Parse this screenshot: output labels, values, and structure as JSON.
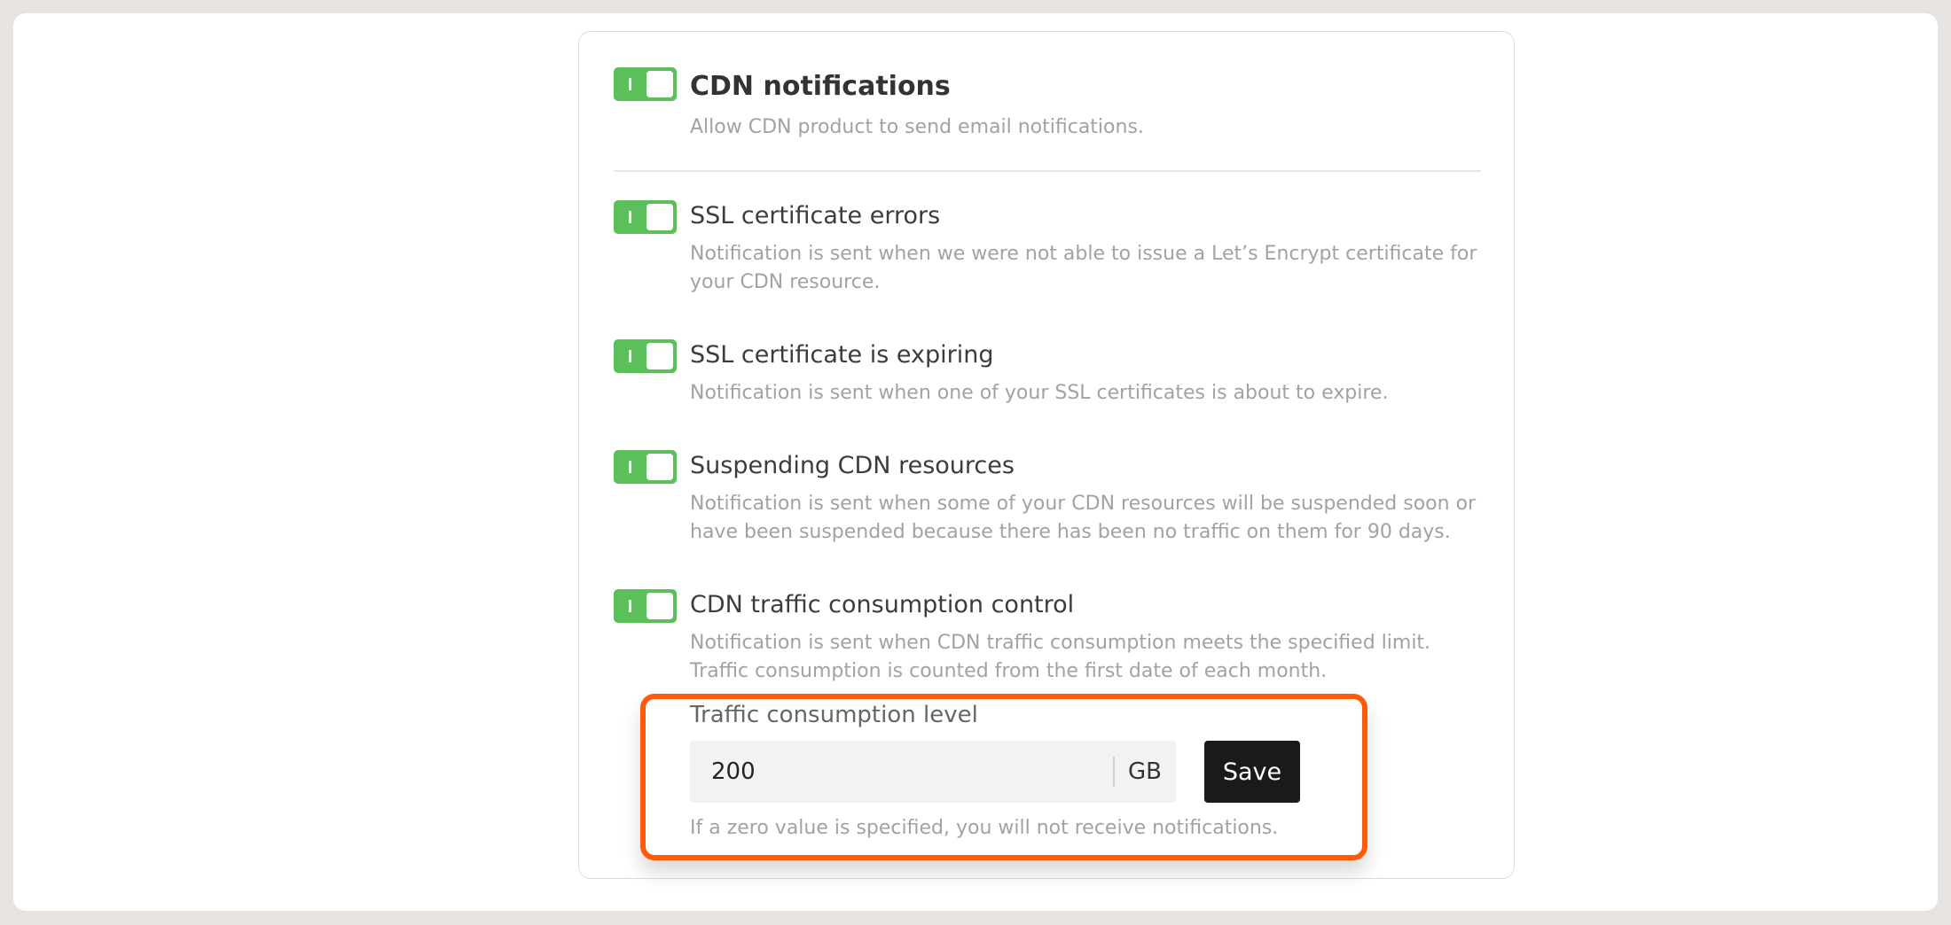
{
  "settings": {
    "main": {
      "title": "CDN notifications",
      "description": "Allow CDN product to send email notifications.",
      "enabled": true
    },
    "items": [
      {
        "title": "SSL certificate errors",
        "description": "Notification is sent when we were not able to issue a Let’s Encrypt certificate for your CDN resource.",
        "enabled": true
      },
      {
        "title": "SSL certificate is expiring",
        "description": "Notification is sent when one of your SSL certificates is about to expire.",
        "enabled": true
      },
      {
        "title": "Suspending CDN resources",
        "description": "Notification is sent when some of your CDN resources will be suspended soon or have been suspended because there has been no traffic on them for 90 days.",
        "enabled": true
      },
      {
        "title": "CDN traffic consumption control",
        "description": "Notification is sent when CDN traffic consumption meets the specified limit. Traffic consumption is counted from the first date of each month.",
        "enabled": true
      }
    ],
    "traffic": {
      "label": "Traffic consumption level",
      "value": "200",
      "unit": "GB",
      "save_label": "Save",
      "hint": "If a zero value is specified, you will not receive notifications."
    }
  },
  "colors": {
    "toggle_on": "#5cc05a",
    "highlight": "#ff5a0a",
    "save_button": "#1a1a1a"
  }
}
